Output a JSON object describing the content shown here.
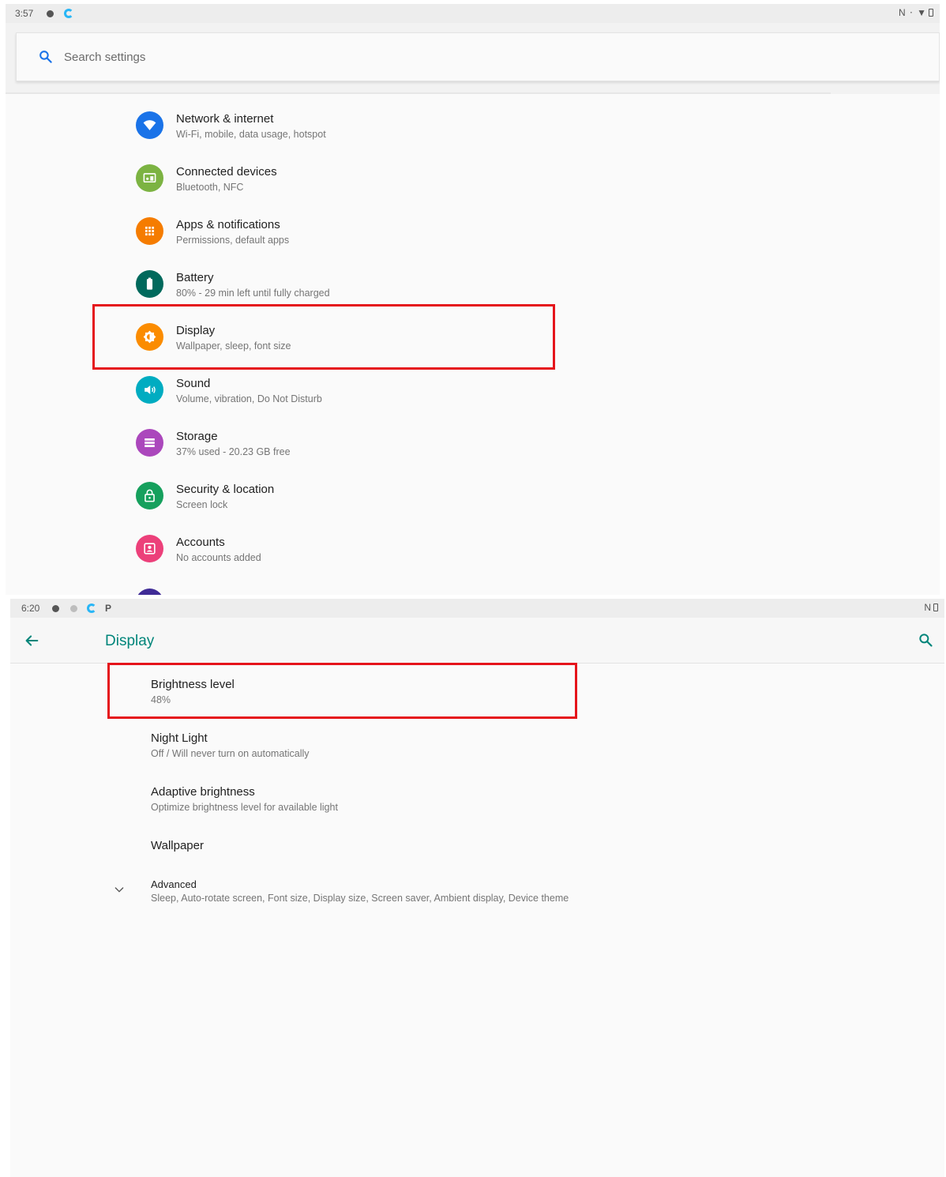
{
  "top": {
    "status_bar": {
      "time": "3:57",
      "right_icons": "N ⋅ ▼"
    },
    "search": {
      "placeholder": "Search settings"
    },
    "items": [
      {
        "title": "Network & internet",
        "subtitle": "Wi-Fi, mobile, data usage, hotspot",
        "icon": "wifi-icon",
        "color": "#1a73e8"
      },
      {
        "title": "Connected devices",
        "subtitle": "Bluetooth, NFC",
        "icon": "devices-icon",
        "color": "#7cb342"
      },
      {
        "title": "Apps & notifications",
        "subtitle": "Permissions, default apps",
        "icon": "apps-icon",
        "color": "#f57c00"
      },
      {
        "title": "Battery",
        "subtitle": "80% - 29 min left until fully charged",
        "icon": "battery-icon",
        "color": "#00695c"
      },
      {
        "title": "Display",
        "subtitle": "Wallpaper, sleep, font size",
        "icon": "brightness-icon",
        "color": "#fb8c00"
      },
      {
        "title": "Sound",
        "subtitle": "Volume, vibration, Do Not Disturb",
        "icon": "volume-icon",
        "color": "#00acc1"
      },
      {
        "title": "Storage",
        "subtitle": "37% used - 20.23 GB free",
        "icon": "storage-icon",
        "color": "#ab47bc"
      },
      {
        "title": "Security & location",
        "subtitle": "Screen lock",
        "icon": "lock-icon",
        "color": "#16a05d"
      },
      {
        "title": "Accounts",
        "subtitle": "No accounts added",
        "icon": "account-icon",
        "color": "#ec407a"
      }
    ],
    "highlight_color": "#e5141b"
  },
  "bottom": {
    "status_bar": {
      "time": "6:20",
      "right_icons": "N"
    },
    "appbar": {
      "title": "Display",
      "accent": "#00857a"
    },
    "items": [
      {
        "title": "Brightness level",
        "subtitle": "48%"
      },
      {
        "title": "Night Light",
        "subtitle": "Off / Will never turn on automatically"
      },
      {
        "title": "Adaptive brightness",
        "subtitle": "Optimize brightness level for available light"
      },
      {
        "title": "Wallpaper"
      },
      {
        "title": "Advanced",
        "subtitle": "Sleep, Auto-rotate screen, Font size, Display size, Screen saver, Ambient display, Device theme",
        "icon": "chevron-down-icon"
      }
    ]
  }
}
